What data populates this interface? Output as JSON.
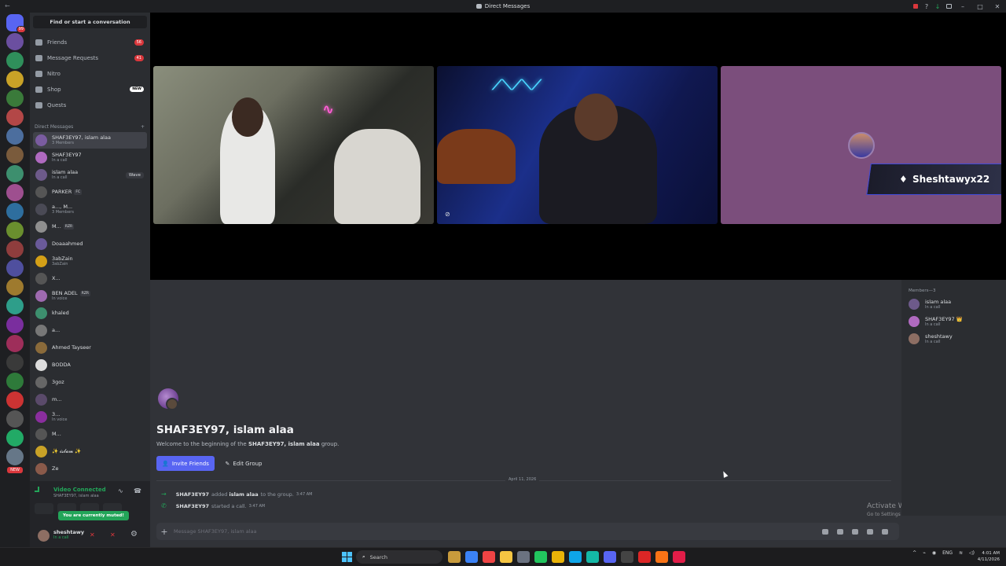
{
  "window": {
    "title": "Direct Messages"
  },
  "colors": {
    "blurple": "#5865f2",
    "green": "#23a559",
    "red": "#da373c",
    "sidebar": "#2b2d31",
    "chat_bg": "#313338"
  },
  "server_rail": {
    "home_badge": "99",
    "new_label": "NEW"
  },
  "sidebar": {
    "find_placeholder": "Find or start a conversation",
    "nav": [
      {
        "label": "Friends",
        "icon": "friends-icon",
        "count": "56"
      },
      {
        "label": "Message Requests",
        "icon": "mail-icon",
        "count": "41"
      },
      {
        "label": "Nitro",
        "icon": "nitro-icon"
      },
      {
        "label": "Shop",
        "icon": "shop-icon",
        "badge": "NEW"
      },
      {
        "label": "Quests",
        "icon": "quests-icon"
      }
    ],
    "dm_header": "Direct Messages",
    "dms": [
      {
        "name": "SHAF3EY97, islam alaa",
        "sub": "3 Members",
        "active": true
      },
      {
        "name": "SHAF3EY97",
        "sub": "In a call"
      },
      {
        "name": "islam alaa",
        "sub": "In a call",
        "action": "Wave"
      },
      {
        "name": "PARKER",
        "tag": "FC"
      },
      {
        "name": "a..., M...",
        "sub": "3 Members"
      },
      {
        "name": "M...",
        "tag": "RZR"
      },
      {
        "name": "Doaaahmed"
      },
      {
        "name": "3abZain",
        "sub": "3abZain"
      },
      {
        "name": "X..."
      },
      {
        "name": "BEN ADEL",
        "sub": "In voice",
        "tag": "RZR"
      },
      {
        "name": "khaled"
      },
      {
        "name": "a..."
      },
      {
        "name": "Ahmed Tayseer"
      },
      {
        "name": "BODDA"
      },
      {
        "name": "3goz"
      },
      {
        "name": "m..."
      },
      {
        "name": "3...",
        "sub": "In voice"
      },
      {
        "name": "M..."
      },
      {
        "name": "✨ 𝓲𝓼𝓵𝓪𝓶 ✨"
      },
      {
        "name": "Ze"
      }
    ]
  },
  "voice": {
    "status": "Video Connected",
    "channel": "SHAF3EY97, islam alaa",
    "muted_tooltip": "You are currently muted!"
  },
  "user": {
    "name": "sheshtawy",
    "status": "In a call"
  },
  "stream": {
    "overlay_name": "Sheshtawyx22"
  },
  "members": {
    "header": "Members—3",
    "list": [
      {
        "name": "islam alaa",
        "status": "In a call"
      },
      {
        "name": "SHAF3EY97 👑",
        "status": "In a call"
      },
      {
        "name": "sheshtawy",
        "status": "In a call"
      }
    ]
  },
  "chat": {
    "group_title": "SHAF3EY97, islam alaa",
    "welcome_prefix": "Welcome to the beginning of the ",
    "welcome_group": "SHAF3EY97, islam alaa",
    "welcome_suffix": " group.",
    "invite_label": "Invite Friends",
    "edit_label": "Edit Group",
    "date_divider": "April 11, 2026",
    "messages": [
      {
        "actor": "SHAF3EY97",
        "text": "added",
        "target": "islam alaa",
        "tail": "to the group.",
        "time": "3:47 AM"
      },
      {
        "actor": "SHAF3EY97",
        "text": "started a call.",
        "time": "3:47 AM"
      }
    ],
    "input_placeholder": "Message SHAF3EY97, islam alaa"
  },
  "watermark": {
    "title": "Activate Windows",
    "subtitle": "Go to Settings to activate Windows."
  },
  "taskbar": {
    "search": "Search",
    "lang": "ENG",
    "time": "4:01 AM",
    "date": "4/11/2026"
  }
}
